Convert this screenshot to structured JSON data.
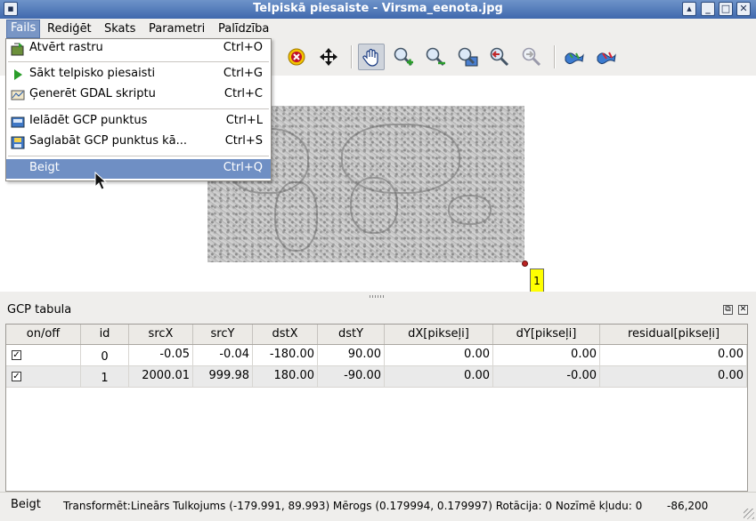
{
  "window": {
    "title": "Telpiskā piesaiste - Virsma_eenota.jpg"
  },
  "menubar": [
    "Fails",
    "Rediģēt",
    "Skats",
    "Parametri",
    "Palīdzība"
  ],
  "file_menu": {
    "items": [
      {
        "label": "Atvērt rastru",
        "shortcut": "Ctrl+O",
        "icon": "open-raster-icon"
      },
      {
        "label": "Sākt telpisko piesaisti",
        "shortcut": "Ctrl+G",
        "icon": "play-icon"
      },
      {
        "label": "Ģenerēt GDAL skriptu",
        "shortcut": "Ctrl+C",
        "icon": "gdal-icon"
      },
      {
        "label": "Ielādēt GCP punktus",
        "shortcut": "Ctrl+L",
        "icon": "load-gcp-icon"
      },
      {
        "label": "Saglabāt GCP punktus kā...",
        "shortcut": "Ctrl+S",
        "icon": "save-gcp-icon"
      },
      {
        "label": "Beigt",
        "shortcut": "Ctrl+Q",
        "icon": ""
      }
    ]
  },
  "canvas": {
    "gcp_marker_label": "1"
  },
  "gcp_panel": {
    "title": "GCP tabula",
    "columns": [
      "on/off",
      "id",
      "srcX",
      "srcY",
      "dstX",
      "dstY",
      "dX[pikseļi]",
      "dY[pikseļi]",
      "residual[pikseļi]"
    ],
    "rows": [
      {
        "on": "✓",
        "id": "0",
        "srcX": "-0.05",
        "srcY": "-0.04",
        "dstX": "-180.00",
        "dstY": "90.00",
        "dX": "0.00",
        "dY": "0.00",
        "residual": "0.00"
      },
      {
        "on": "✓",
        "id": "1",
        "srcX": "2000.01",
        "srcY": "999.98",
        "dstX": "180.00",
        "dstY": "-90.00",
        "dX": "0.00",
        "dY": "-0.00",
        "residual": "0.00"
      }
    ]
  },
  "statusbar": {
    "message": "Beigt",
    "info": "Transformēt:Lineārs Tulkojums (-179.991, 89.993) Mērogs (0.179994, 0.179997) Rotācija: 0 Nozīmē kļudu: 0",
    "coords": "-86,200"
  },
  "colors": {
    "title_bar": "#4f76b8",
    "menu_highlight": "#6f8fc4",
    "gcp_label": "#ffff00"
  }
}
